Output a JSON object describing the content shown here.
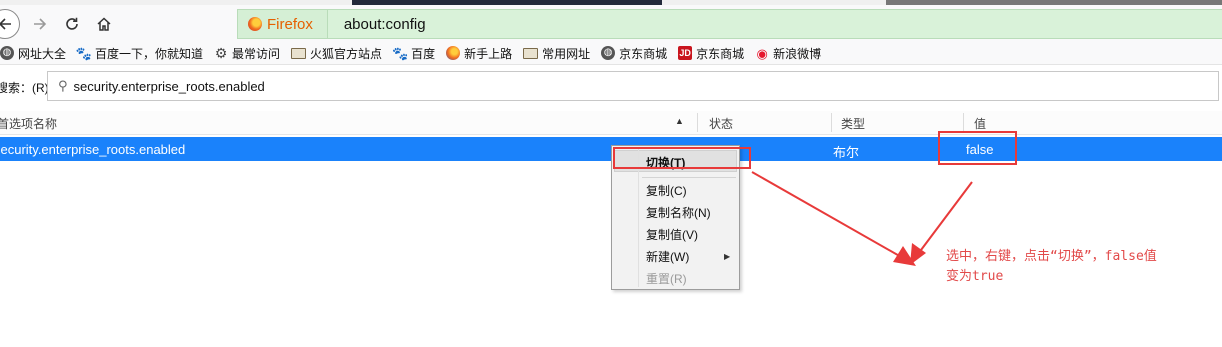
{
  "nav": {
    "back_icon": "back-arrow-icon",
    "forward_icon": "forward-arrow-icon",
    "reload_icon": "reload-icon",
    "home_icon": "home-icon"
  },
  "urlbar": {
    "identity_label": "Firefox",
    "url": "about:config",
    "background_color": "#d9f2d9"
  },
  "bookmarks": [
    {
      "label": "网址大全",
      "icon": "globe-icon"
    },
    {
      "label": "百度一下，你就知道",
      "icon": "baidu-paw-icon"
    },
    {
      "label": "最常访问",
      "icon": "gear-icon"
    },
    {
      "label": "火狐官方站点",
      "icon": "folder-icon"
    },
    {
      "label": "百度",
      "icon": "baidu-paw-icon"
    },
    {
      "label": "新手上路",
      "icon": "firefox-icon"
    },
    {
      "label": "常用网址",
      "icon": "folder-icon"
    },
    {
      "label": "京东商城",
      "icon": "globe-icon"
    },
    {
      "label": "京东商城",
      "icon": "jd-icon"
    },
    {
      "label": "新浪微博",
      "icon": "weibo-icon"
    }
  ],
  "search": {
    "label": "搜索：(R)",
    "value": "security.enterprise_roots.enabled"
  },
  "table": {
    "headers": {
      "name": "首选项名称",
      "status": "状态",
      "type": "类型",
      "value": "值"
    },
    "selected_row": {
      "name": "security.enterprise_roots.enabled",
      "type": "布尔",
      "value": "false"
    },
    "selection_color": "#1a82fb"
  },
  "context_menu": {
    "toggle": "切换(T)",
    "copy": "复制(C)",
    "copy_name": "复制名称(N)",
    "copy_value": "复制值(V)",
    "new": "新建(W)",
    "reset": "重置(R)"
  },
  "annotation": {
    "line1": "选中，右键，点击“切换”，false值",
    "line2": "变为true",
    "color": "#e83a3a"
  }
}
